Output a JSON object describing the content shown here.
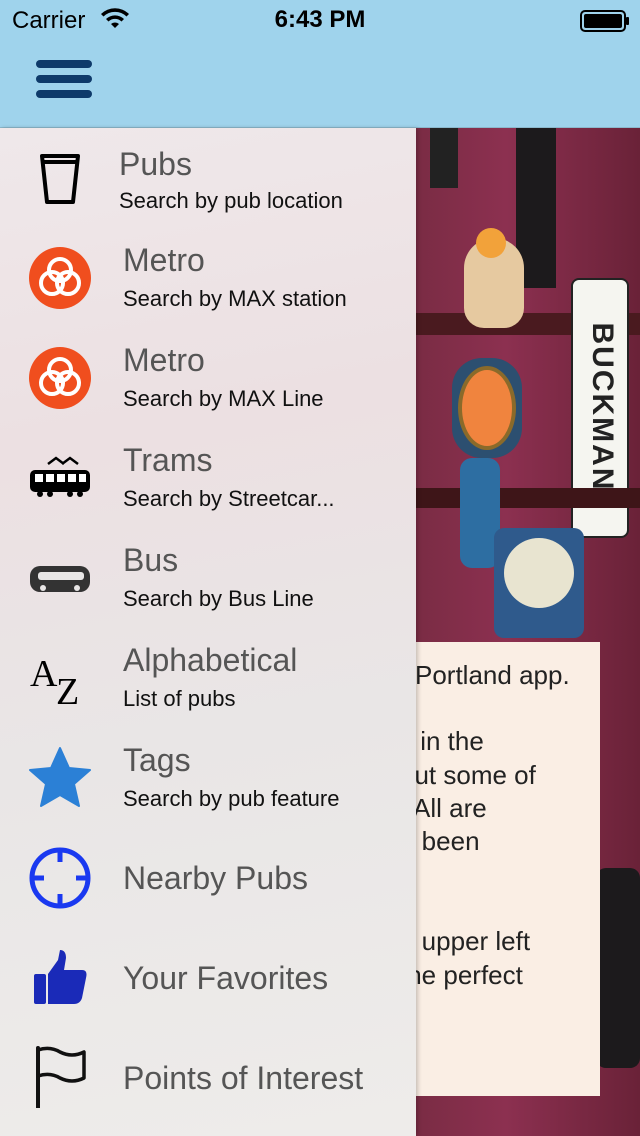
{
  "status_bar": {
    "carrier": "Carrier",
    "time": "6:43 PM"
  },
  "nav": {
    "menu_icon": "hamburger-icon"
  },
  "background": {
    "sign_text": "BUCKMAN",
    "welcome_lines": [
      "Portland app.",
      "s in the",
      "out some of",
      ". All are",
      "e been",
      "e upper left",
      "the perfect"
    ]
  },
  "menu": {
    "items": [
      {
        "title": "Pubs",
        "subtitle": "Search by pub location",
        "icon": "pint-glass-icon"
      },
      {
        "title": "Metro",
        "subtitle": "Search by MAX station",
        "icon": "metro-logo-icon"
      },
      {
        "title": "Metro",
        "subtitle": "Search by MAX Line",
        "icon": "metro-logo-icon"
      },
      {
        "title": "Trams",
        "subtitle": "Search by Streetcar...",
        "icon": "streetcar-icon"
      },
      {
        "title": "Bus",
        "subtitle": "Search by Bus Line",
        "icon": "bus-icon"
      },
      {
        "title": "Alphabetical",
        "subtitle": "List of pubs",
        "icon": "az-icon"
      },
      {
        "title": "Tags",
        "subtitle": "Search by pub feature",
        "icon": "star-icon"
      },
      {
        "title": "Nearby Pubs",
        "icon": "location-target-icon"
      },
      {
        "title": "Your Favorites",
        "icon": "thumbs-up-icon"
      },
      {
        "title": "Points of Interest",
        "icon": "flag-icon"
      }
    ]
  },
  "colors": {
    "nav_bg": "#9fd3ec",
    "metro_orange": "#f04e1e",
    "tag_blue": "#2b80d6",
    "nearby_blue": "#1a39f0",
    "favorite_blue": "#1a2ab8"
  }
}
